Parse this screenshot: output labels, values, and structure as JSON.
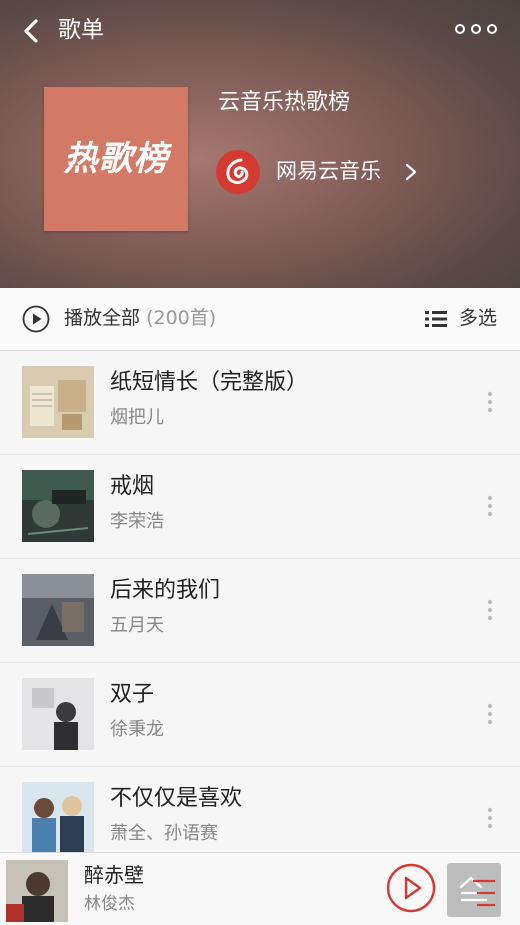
{
  "nav": {
    "title": "歌单"
  },
  "playlist": {
    "cover_text": "热歌榜",
    "title": "云音乐热歌榜",
    "creator": "网易云音乐"
  },
  "playbar": {
    "play_all_label": "播放全部",
    "play_all_count": "(200首)",
    "multi_select_label": "多选"
  },
  "songs": [
    {
      "title": "纸短情长（完整版）",
      "artist": "烟把儿"
    },
    {
      "title": "戒烟",
      "artist": "李荣浩"
    },
    {
      "title": "后来的我们",
      "artist": "五月天"
    },
    {
      "title": "双子",
      "artist": "徐秉龙"
    },
    {
      "title": "不仅仅是喜欢",
      "artist": "萧全、孙语赛"
    }
  ],
  "now_playing": {
    "title": "醉赤壁",
    "artist": "林俊杰"
  },
  "colors": {
    "accent": "#d33a31",
    "cover_bg": "#d27a66"
  }
}
